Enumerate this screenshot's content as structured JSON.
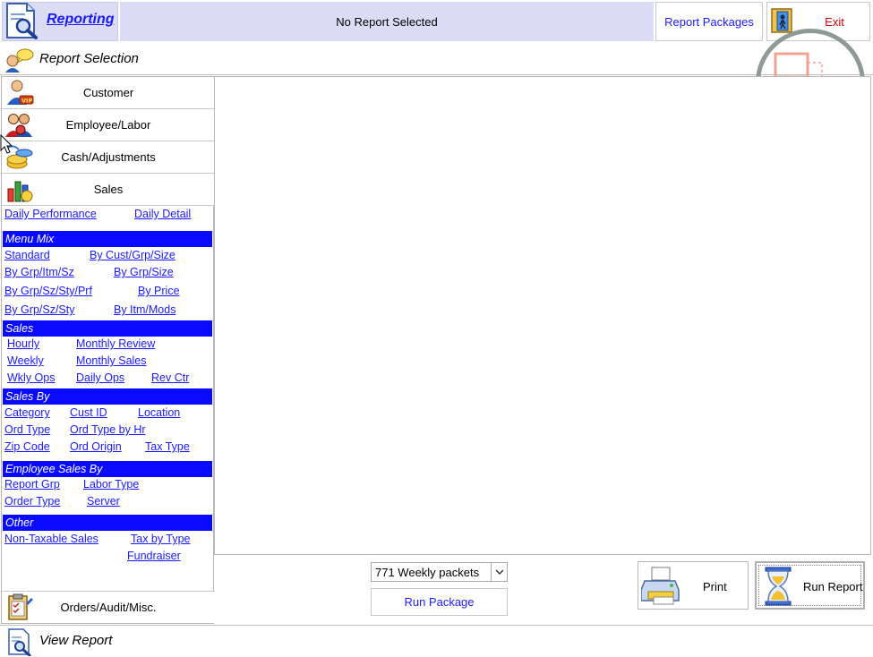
{
  "header": {
    "title": "Reporting",
    "status": "No Report Selected",
    "report_packages_label": "Report Packages",
    "exit_label": "Exit"
  },
  "report_selection": {
    "title": "Report Selection"
  },
  "categories": {
    "customer": "Customer",
    "employee": "Employee/Labor",
    "cash": "Cash/Adjustments",
    "sales": "Sales",
    "orders": "Orders/Audit/Misc."
  },
  "sales_reports": {
    "daily_performance": "Daily Performance",
    "daily_detail": "Daily Detail",
    "menu_mix": {
      "heading": "Menu Mix",
      "standard": "Standard",
      "by_cust_grp_size": "By Cust/Grp/Size",
      "by_grp_itm_sz": "By Grp/Itm/Sz",
      "by_grp_size": "By Grp/Size",
      "by_grp_sz_sty_prf": "By Grp/Sz/Sty/Prf",
      "by_price": "By Price",
      "by_grp_sz_sty": "By Grp/Sz/Sty",
      "by_itm_mods": "By Itm/Mods"
    },
    "sales": {
      "heading": "Sales",
      "hourly": "Hourly",
      "monthly_review": "Monthly Review",
      "weekly": "Weekly",
      "monthly_sales": "Monthly Sales",
      "wkly_ops": "Wkly Ops",
      "daily_ops": "Daily Ops",
      "rev_ctr": "Rev Ctr"
    },
    "sales_by": {
      "heading": "Sales By",
      "category": "Category",
      "cust_id": "Cust ID",
      "location": "Location",
      "ord_type": "Ord Type",
      "ord_type_by_hr": "Ord Type by Hr",
      "zip_code": "Zip Code",
      "ord_origin": "Ord Origin",
      "tax_type": "Tax Type"
    },
    "employee_sales_by": {
      "heading": "Employee Sales By",
      "report_grp": "Report Grp",
      "labor_type": "Labor Type",
      "order_type": "Order Type",
      "server": "Server"
    },
    "other": {
      "heading": "Other",
      "non_taxable": "Non-Taxable Sales",
      "tax_by_type": "Tax by Type",
      "fundraiser": "Fundraiser"
    }
  },
  "controls": {
    "package_selected": "771 Weekly packets",
    "run_package": "Run Package",
    "print": "Print",
    "run_report": "Run Report"
  },
  "view_report": {
    "title": "View Report"
  }
}
